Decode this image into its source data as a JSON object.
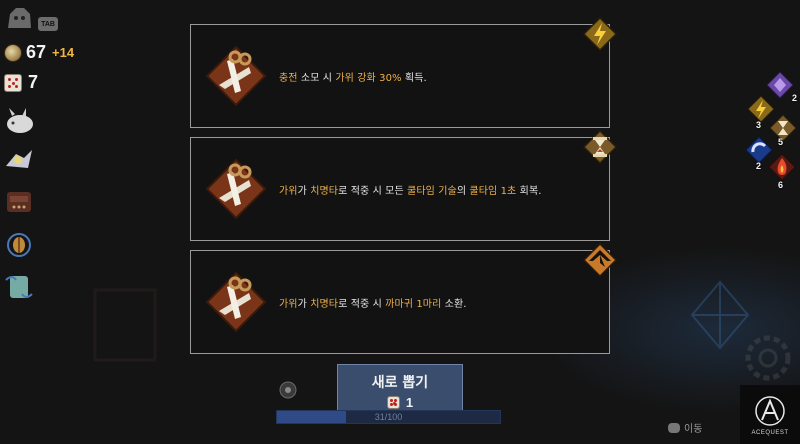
{
  "hud": {
    "tab_key": "TAB",
    "coins": "67",
    "coin_gain": "+14",
    "dice": "7"
  },
  "relics": [
    {
      "icon": "horned-pig-relic-icon"
    },
    {
      "icon": "crystal-bird-relic-icon"
    },
    {
      "icon": "satchel-relic-icon"
    },
    {
      "icon": "bronze-scarab-relic-icon"
    },
    {
      "icon": "glass-jar-relic-icon"
    }
  ],
  "cards": [
    {
      "icon": "scissors-icon",
      "badge": "lightning-badge-icon",
      "segments": [
        {
          "text": "충전",
          "hl": true
        },
        {
          "text": " 소모 시 ",
          "hl": false
        },
        {
          "text": "가위 강화 30%",
          "hl": true
        },
        {
          "text": " 획득.",
          "hl": false
        }
      ]
    },
    {
      "icon": "scissors-icon",
      "badge": "hourglass-badge-icon",
      "segments": [
        {
          "text": "가위",
          "hl": true
        },
        {
          "text": "가 ",
          "hl": false
        },
        {
          "text": "치명타",
          "hl": true
        },
        {
          "text": "로 적중 시 모든 ",
          "hl": false
        },
        {
          "text": "쿨타임 기술",
          "hl": true
        },
        {
          "text": "의 ",
          "hl": false
        },
        {
          "text": "쿨타임 1초",
          "hl": true
        },
        {
          "text": " 회복.",
          "hl": false
        }
      ]
    },
    {
      "icon": "scissors-icon",
      "badge": "crow-badge-icon",
      "segments": [
        {
          "text": "가위",
          "hl": true
        },
        {
          "text": "가 ",
          "hl": false
        },
        {
          "text": "치명타",
          "hl": true
        },
        {
          "text": "로 적중 시 ",
          "hl": false
        },
        {
          "text": "까마귀 1마리",
          "hl": true
        },
        {
          "text": " 소환.",
          "hl": false
        }
      ]
    }
  ],
  "skills": [
    {
      "icon": "purple-crystal-skill-icon",
      "count": "2"
    },
    {
      "icon": "lightning-skill-icon",
      "count": "3"
    },
    {
      "icon": "hourglass-skill-icon",
      "count": "5"
    },
    {
      "icon": "blue-magnet-skill-icon",
      "count": "2"
    },
    {
      "icon": "fire-skill-icon",
      "count": "6"
    }
  ],
  "redraw": {
    "label": "새로 뽑기",
    "cost": "1"
  },
  "progress": {
    "text": "31/100",
    "fraction": 0.31
  },
  "move_hint": "이동",
  "logo": "ACEQUEST",
  "colors": {
    "highlight": "#f0b14a",
    "button": "#3a4d6d",
    "card_border": "#9a9a9a"
  }
}
